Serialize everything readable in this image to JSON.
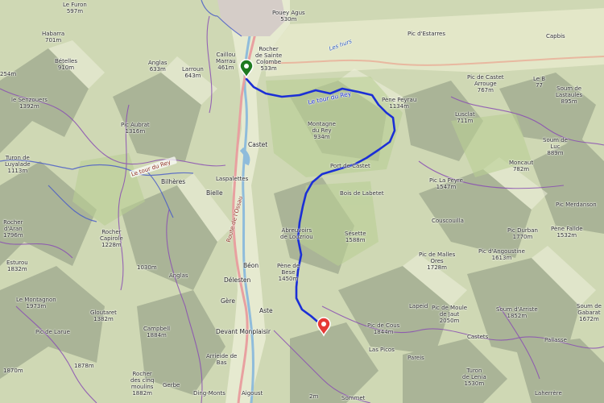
{
  "map": {
    "colors": {
      "forest": "#c6d6a6",
      "relief_dark": "#7f8b78",
      "valley": "#e9ecd2",
      "route": "#1b2fd6",
      "start_marker": "#1f7a1f",
      "end_marker": "#e53935",
      "road": "#e8a0a0",
      "river": "#8fbcdb",
      "trail_purple": "#8a4fb3"
    },
    "markers": {
      "start": {
        "type": "green-pin",
        "label": "start"
      },
      "end": {
        "type": "red-pin",
        "label": "end"
      }
    },
    "route_name": "Le tour du Rey",
    "labels": {
      "furon": "Le Furon",
      "furon_alt": "597m",
      "habarra": "Habarra",
      "habarra_alt": "701m",
      "betelles": "Bételles",
      "betelles_alt": "910m",
      "senzouers": "le Senzouers",
      "senzouers_alt": "1392m",
      "alt_254": "254m",
      "anglas": "Anglas",
      "anglas_alt": "633m",
      "larroun": "Larroun",
      "larroun_alt": "643m",
      "caillou_marrau": "Caillou",
      "caillou_marrau2": "Marrau",
      "caillou_alt": "461m",
      "rocher_ste_colombe": "Rocher",
      "rocher_ste_colombe2": "de Sainte",
      "rocher_ste_colombe3": "Colombe",
      "rocher_ste_colombe_alt": "533m",
      "pouey_aguas": "Pouey Agus",
      "pouey_alt": "530m",
      "les_hurs": "Les hurs",
      "pic_estarres": "Pic d'Estarres",
      "capbis": "Capbis",
      "pic_castet": "Pic de Castet",
      "pic_castet2": "Arrouge",
      "pic_castet_alt": "767m",
      "le_b": "Le B",
      "le_b_alt": "77",
      "soum_lastaules": "Soum de",
      "soum_lastaules2": "Lastaules",
      "soum_lastaules_alt": "895m",
      "pene_peyrau": "Pène Peyrau",
      "pene_peyrau_alt": "1134m",
      "luzclat": "Lusclat",
      "luzclat_alt": "711m",
      "soum_luc": "Soum de",
      "soum_luc2": "Luc",
      "soum_luc_alt": "889m",
      "montagne_rey": "Montagne",
      "montagne_rey2": "du Rey",
      "montagne_rey_alt": "934m",
      "pic_aubrat": "Pic Aubrat",
      "pic_aubrat_alt": "1316m",
      "turon_luyalade": "Turon de",
      "turon_luyalade2": "Luyalade",
      "turon_luyalade_alt": "1113m",
      "castet": "Castet",
      "port_castet": "Port de Castet",
      "moncaut": "Moncaut",
      "moncaut_alt": "782m",
      "bilheres": "Bilhères",
      "bielle": "Bielle",
      "laspalettes": "Laspalettes",
      "bois_labetet": "Bois de Labetet",
      "pic_peyre": "Pic La Peyre",
      "pic_peyre_alt": "1547m",
      "pic_merdanson": "Pic Merdanson",
      "couscouilla": "Couscouilla",
      "abrevadors": "Abreuvoirs",
      "abrevadors2": "de Louzriou",
      "seselle": "Sésette",
      "seselle_alt": "1588m",
      "pic_durban": "Pic Durban",
      "pic_durban_alt": "1770m",
      "pene_fallde": "Pène Fallde",
      "pene_fallde_alt": "1532m",
      "rocher_aran": "Rocher",
      "rocher_aran2": "d'Aran",
      "rocher_aran_alt": "1796m",
      "rocher_capirole": "Rocher",
      "rocher_capirole2": "Capirole",
      "rocher_capirole_alt": "1228m",
      "pic_malles": "Pic de Malles",
      "pic_malles2": "Ores",
      "pic_malles_alt": "1728m",
      "pic_angoustine": "Pic d'Angoustine",
      "pic_angoustine_alt": "1613m",
      "esturou": "Esturou",
      "esturou_alt": "1832m",
      "alt_1030": "1030m",
      "beon": "Béon",
      "pene_bese": "Pène de",
      "pene_bese2": "Bese",
      "pene_bese_alt": "1450m",
      "anglas2": "Anglas",
      "delesten": "Délesten",
      "le_montagnon": "Le Montagnon",
      "le_montagnon_alt": "1973m",
      "gloutaret": "Gloutaret",
      "gloutaret_alt": "1382m",
      "gere": "Gère",
      "aste": "Aste",
      "lapeid": "Lapeid",
      "pic_moule": "Pic de Moule",
      "pic_moule2": "de Jaut",
      "pic_moule_alt": "2050m",
      "soum_arriste": "Soum d'Arriste",
      "soum_arriste_alt": "1852m",
      "pic_larue": "Pic de Larue",
      "campbell": "Campbell",
      "campbell_alt": "1884m",
      "devant_monplaisir": "Devant Monplaisir",
      "pic_cous": "Pic de Cous",
      "pic_cous_alt": "1844m",
      "soum_gabarat": "Soum de",
      "soum_gabarat2": "Gabarat",
      "soum_gabarat_alt": "1672m",
      "armeide": "Arrieide de",
      "armeide2": "Bas",
      "las_picos": "Las Picos",
      "pareis": "Pareis",
      "castets": "Castets",
      "pallasse": "Pallasse",
      "alt_1878": "1878m",
      "alt_1870": "1870m",
      "rocher_cinq": "Rocher",
      "rocher_cinq2": "des cinq",
      "rocher_cinq3": "moulins",
      "rocher_cinq_alt": "1882m",
      "gerbe": "Gerbe",
      "ding_monts": "Ding-Monts",
      "aigoust": "Aigoust",
      "turon_lenia": "Turon",
      "turon_lenia2": "de Lenia",
      "turon_lenia_alt": "1530m",
      "laherrere": "Laherrère",
      "alt_2m": "2m",
      "sommet": "Sommet",
      "alt_x": "m",
      "route_label": "Le tour du Rey",
      "road_name": "Route de l'Ossau"
    }
  }
}
